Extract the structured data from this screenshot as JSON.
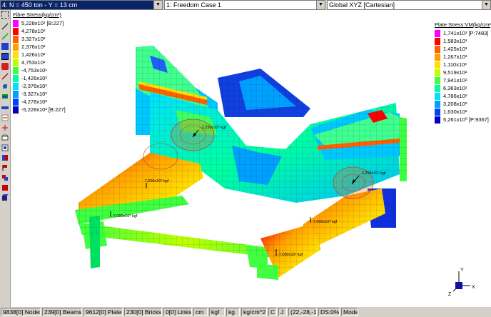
{
  "topbar": {
    "load_case_combo": "4: N = 450 ton - Y = 13 cm",
    "freedom_case_combo": "1: Freedom Case 1",
    "coord_system_combo": "Global XYZ [Cartesian]"
  },
  "legend_left": {
    "title": "Fibre Stress(kg/cm²)",
    "entries": [
      "5,228x10² [B:227]",
      "4,278x10²",
      "3,327x10²",
      "2,376x10²",
      "1,426x10²",
      "4,753x10¹",
      "-4,753x10¹",
      "-1,426x10²",
      "-2,376x10²",
      "-3,327x10²",
      "-4,278x10²",
      "-5,228x10² [B:227]"
    ],
    "colors": [
      "#ff00ff",
      "#ff0000",
      "#ff6000",
      "#ffa000",
      "#ffe000",
      "#c0ff00",
      "#40ff40",
      "#00ffa0",
      "#00e0ff",
      "#00a0ff",
      "#0040ff",
      "#0000c0"
    ]
  },
  "legend_right": {
    "title": "Plate Stress:VM(kg/cm²)",
    "entries": [
      "1,741x10³ [P:7483]",
      "1,583x10³",
      "1,425x10³",
      "1,267x10³",
      "1,110x10³",
      "9,519x10²",
      "7,941x10²",
      "6,363x10²",
      "4,786x10²",
      "3,208x10²",
      "1,630x10²",
      "5,261x10⁰ [P:9367]"
    ],
    "colors": [
      "#ff00ff",
      "#ff0000",
      "#ff6000",
      "#ffa000",
      "#ffe000",
      "#c0ff00",
      "#40ff40",
      "#00ffa0",
      "#00e0ff",
      "#00a0ff",
      "#0040ff",
      "#0000c0"
    ]
  },
  "annotations": {
    "load1": "-2,250x10⁵ kgf",
    "load2": "-2,250x10⁵ kgf",
    "load3": "-7,000x10³ kgf",
    "load4": "-7,000x10³ kgf",
    "load5": "-7,000x10³ kgf",
    "load6": "-7,000x10³ kgf"
  },
  "axes": {
    "x": "X",
    "y": "Y",
    "z": "Z"
  },
  "statusbar": {
    "nodes": "9838[0] Nodes",
    "beams": "239[0] Beams",
    "plates": "9612[0] Plates",
    "bricks": "230[0] Bricks",
    "links": "0[0] Links",
    "unit_length": "cm",
    "unit_force": "kgf",
    "unit_mass": "kg",
    "unit_stress": "kg/cm^2",
    "unit_temp": "C",
    "unit_energy": "J",
    "view_angle": "(22,-28,-1)",
    "ds": "DS:0%",
    "mode": "Model"
  }
}
